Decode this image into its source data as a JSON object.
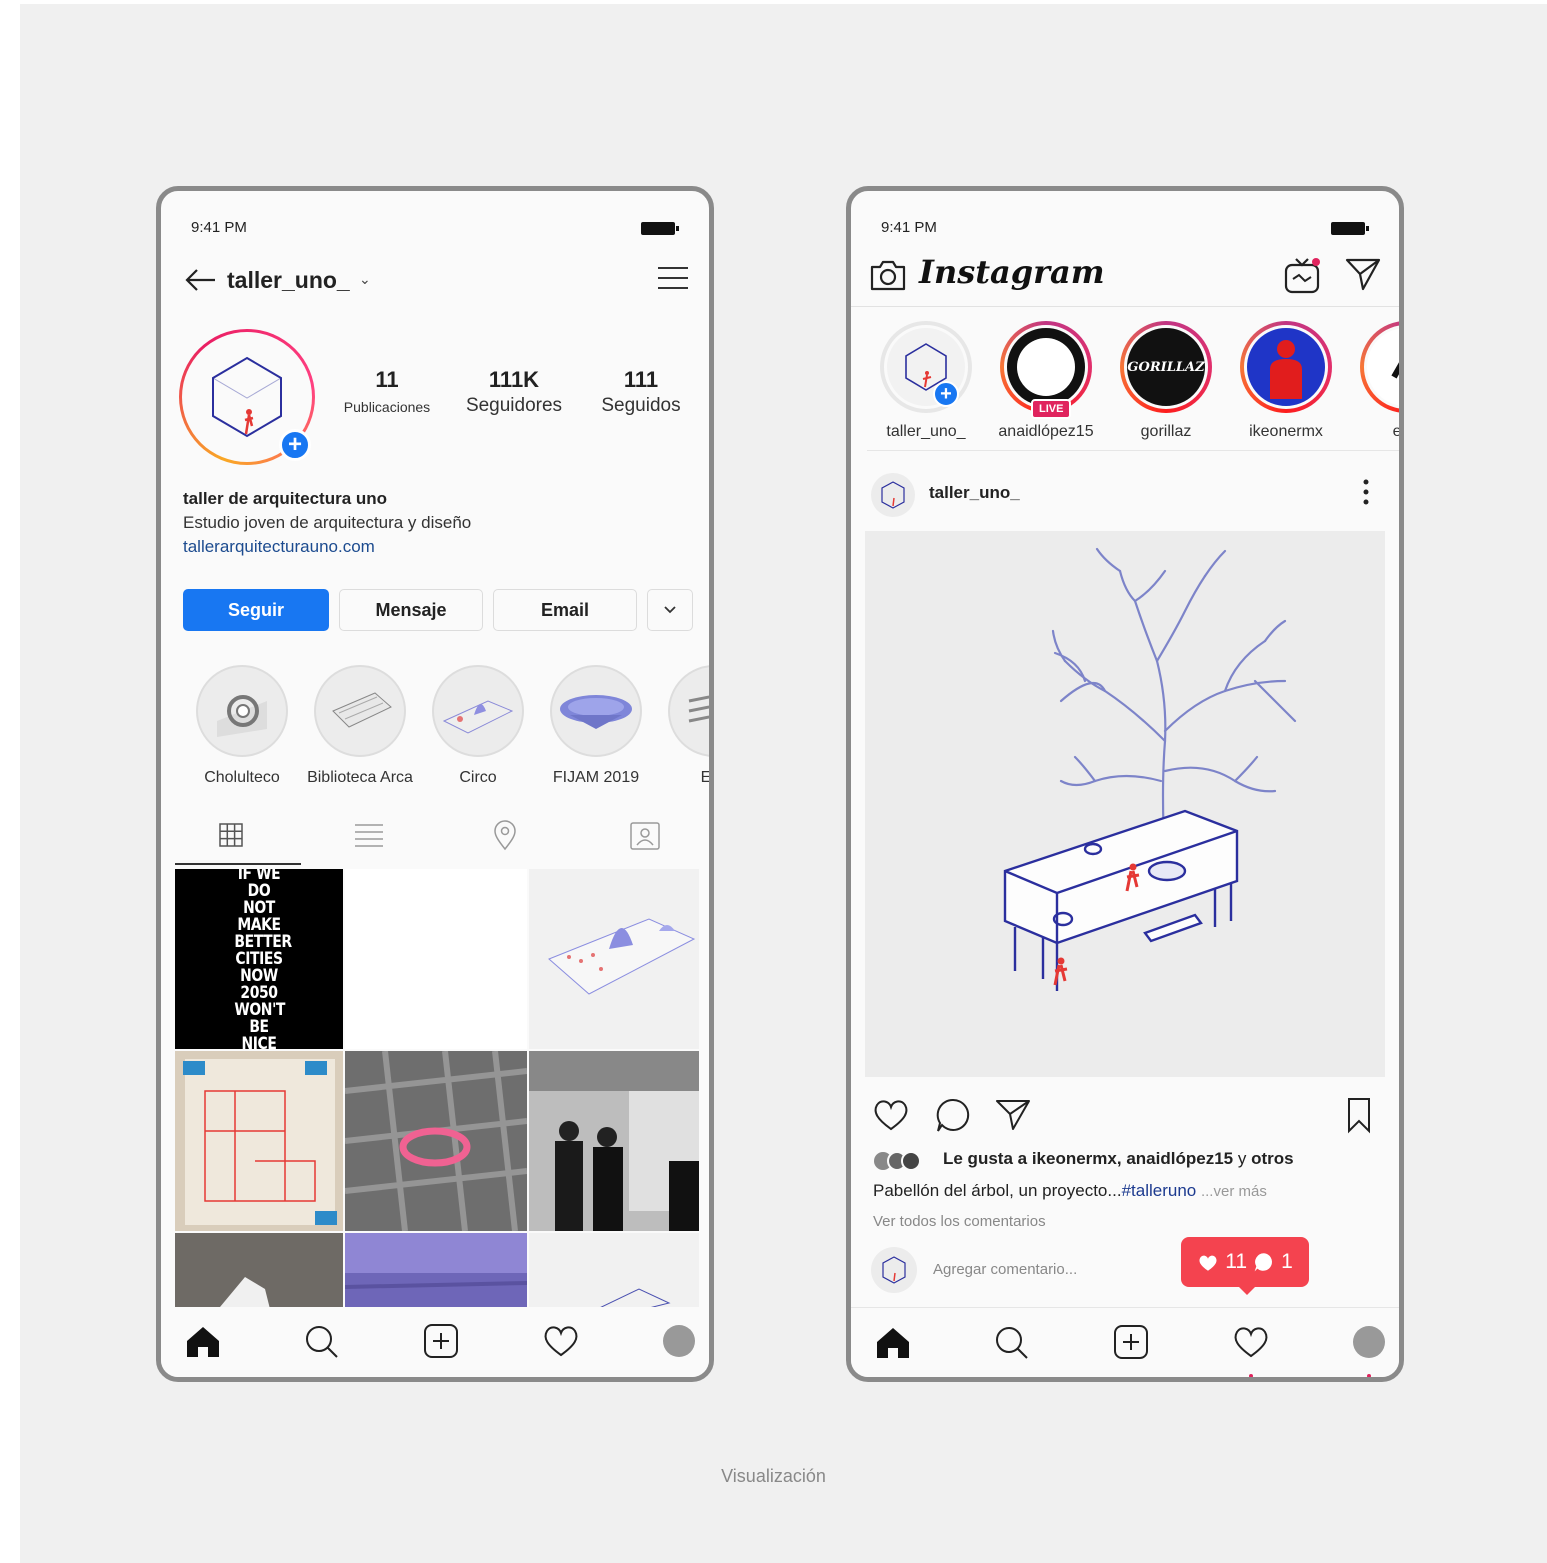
{
  "left_phone": {
    "status_time": "9:41 PM",
    "username": "taller_uno_",
    "stats": {
      "posts_count": "11",
      "posts_label": "Publicaciones",
      "followers_count": "111K",
      "followers_label": "Seguidores",
      "following_count": "111",
      "following_label": "Seguidos"
    },
    "bio": {
      "name": "taller de arquitectura uno",
      "description": "Estudio joven de arquitectura y diseño",
      "link": "tallerarquitecturauno.com"
    },
    "buttons": {
      "follow": "Seguir",
      "message": "Mensaje",
      "email": "Email"
    },
    "highlights": [
      "Cholulteco",
      "Biblioteca Arca",
      "Circo",
      "FIJAM 2019",
      "Esc"
    ],
    "poster_text": "IF WE DO NOT MAKE BETTER CITIES NOW 2050 WON'T BE NICE"
  },
  "right_phone": {
    "status_time": "9:41 PM",
    "app_name": "Instagram",
    "stories": [
      {
        "name": "taller_uno_"
      },
      {
        "name": "anaidlópez15",
        "badge": "LIVE"
      },
      {
        "name": "gorillaz",
        "logo_text": "GORILLAZ"
      },
      {
        "name": "ikeonermx"
      },
      {
        "name": "estr"
      }
    ],
    "post": {
      "username": "taller_uno_",
      "likes_prefix": "Le gusta a",
      "likes_user1": "ikeonermx",
      "likes_user2": "anaidlópez15",
      "likes_suffix": "y",
      "likes_others": "otros",
      "caption_text": "Pabellón del árbol, un proyecto...",
      "caption_tag": "#talleruno",
      "caption_more": "...ver más",
      "view_comments": "Ver todos los comentarios",
      "comment_placeholder": "Agregar comentario..."
    },
    "notification": {
      "likes": "11",
      "comments": "1"
    }
  },
  "footer_caption": "Visualización",
  "colors": {
    "accent_blue": "#1877f2",
    "notification_red": "#f4434f",
    "link_blue": "#1c4b8f",
    "illustration_blue": "#2b2f9e",
    "illustration_red": "#e53935"
  }
}
